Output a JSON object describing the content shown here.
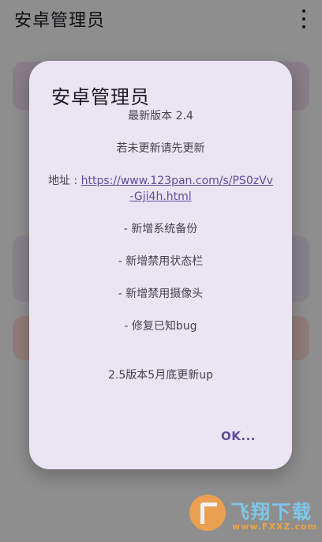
{
  "app": {
    "title": "安卓管理员"
  },
  "dialog": {
    "title": "安卓管理员",
    "version": "最新版本 2.4",
    "notice": "若未更新请先更新",
    "address_label": "地址 : ",
    "address_url_line1": "https://www.123pan.com/s/PS0zVv",
    "address_url_line2": "-Gji4h.html",
    "changes": [
      "- 新增系统备份",
      "- 新增禁用状态栏",
      "- 新增禁用摄像头",
      "- 修复已知bug"
    ],
    "next_update": "2.5版本5月底更新up",
    "ok_label": "OK..."
  },
  "watermark": {
    "text": "飞翔下载",
    "sub": "www.FXXZ.com"
  }
}
